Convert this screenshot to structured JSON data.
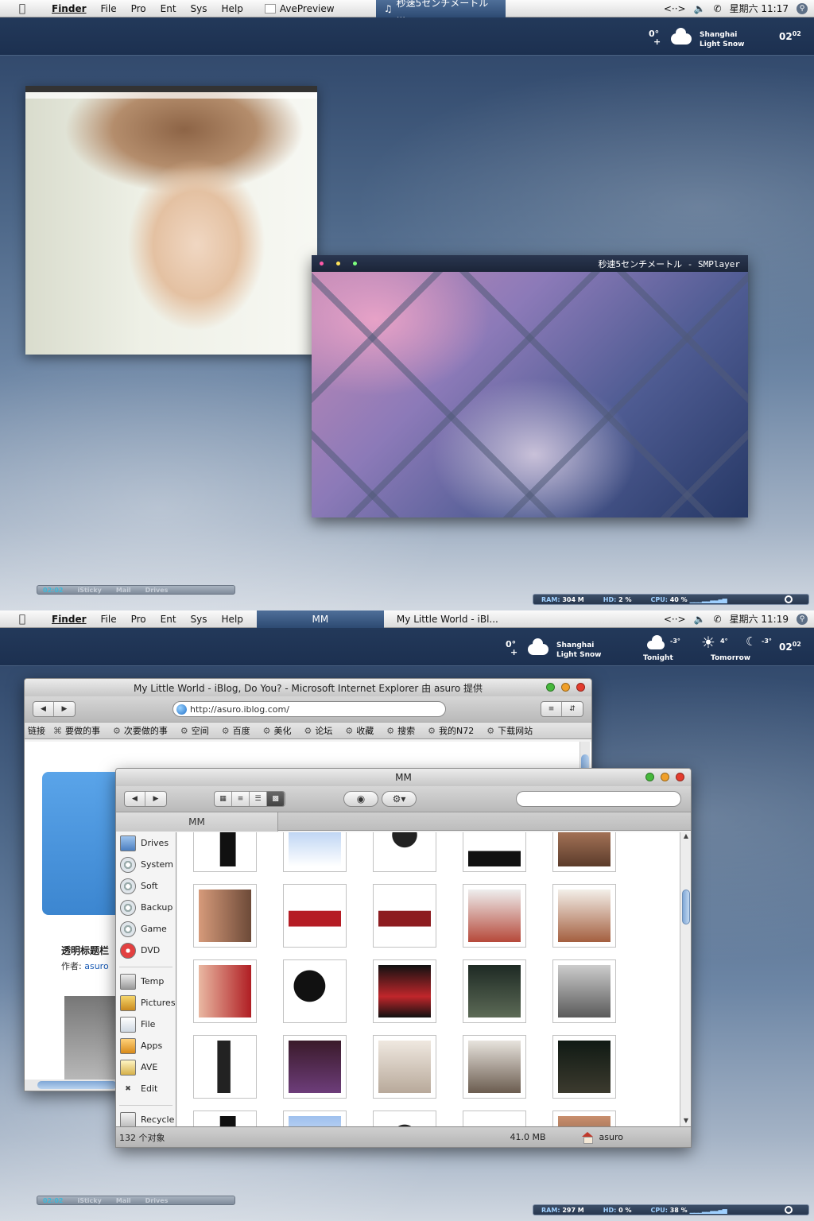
{
  "menubar_items": [
    "Finder",
    "File",
    "Pro",
    "Ent",
    "Sys",
    "Help"
  ],
  "screen1": {
    "menubar": {
      "tabs": [
        "AvePreview",
        "秒速5センチメートル ..."
      ],
      "status_icons": [
        "network-arrows-icon",
        "volume-icon",
        "phone-icon"
      ],
      "clock": "星期六 11:17"
    },
    "weather": {
      "temp": "0°",
      "city": "Shanghai",
      "condition": "Light Snow",
      "date_day": "02",
      "date_month": "02"
    },
    "player": {
      "title": "秒速5センチメートル - SMPlayer"
    },
    "dock": {
      "items": [
        "02:02",
        "iSticky",
        "Mail",
        "Drives"
      ]
    },
    "sysmon": {
      "ram_label": "RAM:",
      "ram": "304 M",
      "hd_label": "HD:",
      "hd": "2 %",
      "cpu_label": "CPU:",
      "cpu": "40 %"
    }
  },
  "screen2": {
    "menubar": {
      "tabs": [
        "MM",
        "My Little World - iBl..."
      ],
      "clock": "星期六 11:19"
    },
    "weather": {
      "temp": "0°",
      "city": "Shanghai",
      "condition": "Light Snow",
      "tonight_temp": "-3°",
      "tonight_label": "Tonight",
      "tomorrow_high": "4°",
      "tomorrow_low": "-3°",
      "tomorrow_label": "Tomorrow",
      "date_day": "02",
      "date_month": "02"
    },
    "ie": {
      "title": "My Little World - iBlog, Do You? - Microsoft Internet Explorer 由 asuro 提供",
      "url": "http://asuro.iblog.com/",
      "links_label": "链接",
      "links": [
        "要做的事",
        "次要做的事",
        "空间",
        "百度",
        "美化",
        "论坛",
        "收藏",
        "搜索",
        "我的N72",
        "下载网站"
      ],
      "article_title": "透明标题栏",
      "author_label": "作者:",
      "author": "asuro"
    },
    "finder": {
      "title": "MM",
      "path_tab": "MM",
      "sidebar": [
        "Drives",
        "System",
        "Soft",
        "Backup",
        "Game",
        "DVD",
        "Temp",
        "Pictures",
        "File",
        "Apps",
        "AVE",
        "Edit",
        "Recycle"
      ],
      "status_count": "132 个对象",
      "status_size": "41.0 MB",
      "status_user": "asuro"
    },
    "dock": {
      "items": [
        "02:02",
        "iSticky",
        "Mail",
        "Drives"
      ]
    },
    "sysmon": {
      "ram_label": "RAM:",
      "ram": "297 M",
      "hd_label": "HD:",
      "hd": "0 %",
      "cpu_label": "CPU:",
      "cpu": "38 %"
    }
  },
  "colors": {
    "accent": "#3c86d0",
    "close": "#e33c2e",
    "minimize": "#f0a02a",
    "zoom": "#46b83c"
  }
}
